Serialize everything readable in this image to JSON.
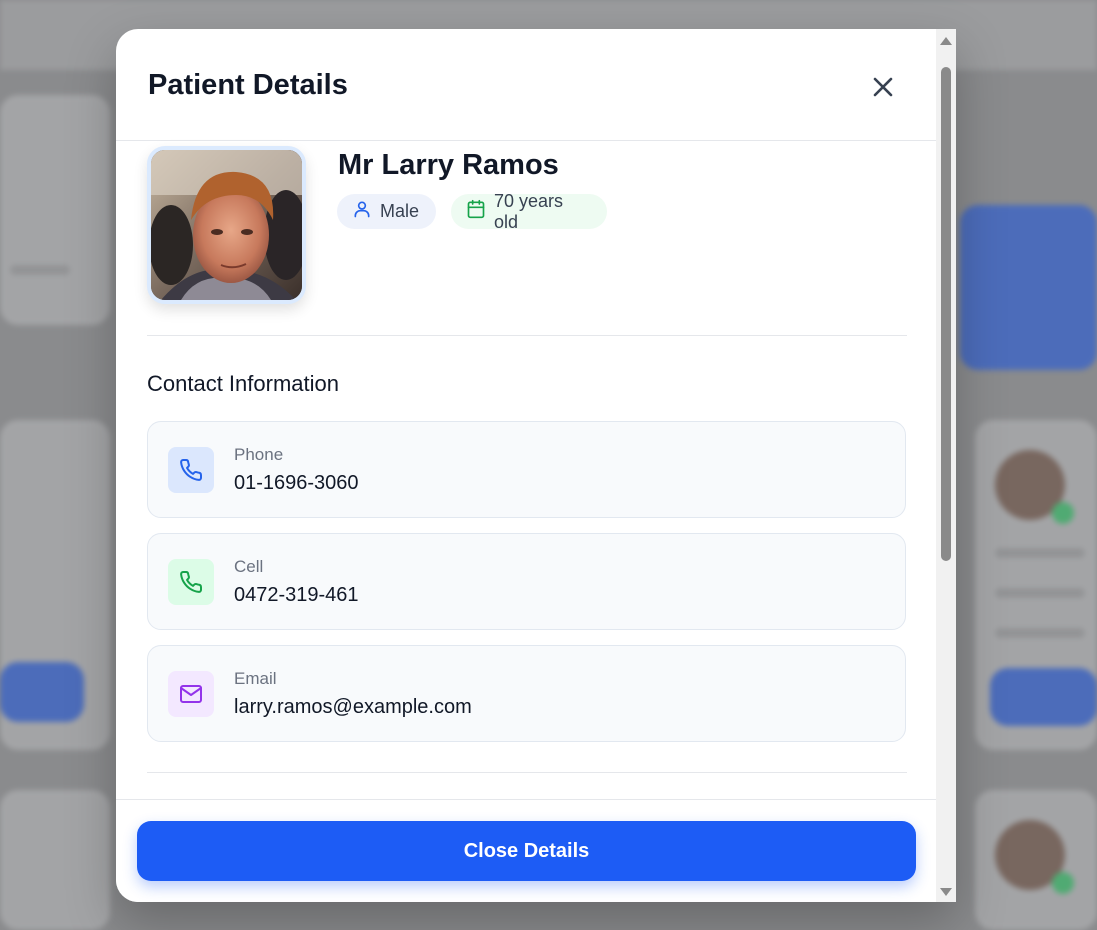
{
  "modal": {
    "title": "Patient Details",
    "close_icon": "close-icon",
    "scrollbar": {
      "thumb_position": 0.0
    }
  },
  "patient": {
    "name": "Mr Larry Ramos",
    "gender": "Male",
    "age": "70 years old",
    "gender_icon": "user-icon",
    "age_icon": "calendar-icon"
  },
  "contact": {
    "section_title": "Contact Information",
    "items": [
      {
        "label": "Phone",
        "value": "01-1696-3060",
        "icon": "phone-icon",
        "color": "#2563eb",
        "bg": "#dbe7fd"
      },
      {
        "label": "Cell",
        "value": "0472-319-461",
        "icon": "phone-icon",
        "color": "#16a34a",
        "bg": "#dcfce7"
      },
      {
        "label": "Email",
        "value": "larry.ramos@example.com",
        "icon": "mail-icon",
        "color": "#9333ea",
        "bg": "#f3e8ff"
      }
    ]
  },
  "footer": {
    "close_button_label": "Close Details"
  },
  "colors": {
    "primary": "#1d5cf5",
    "overlay": "#8a8b8d"
  }
}
